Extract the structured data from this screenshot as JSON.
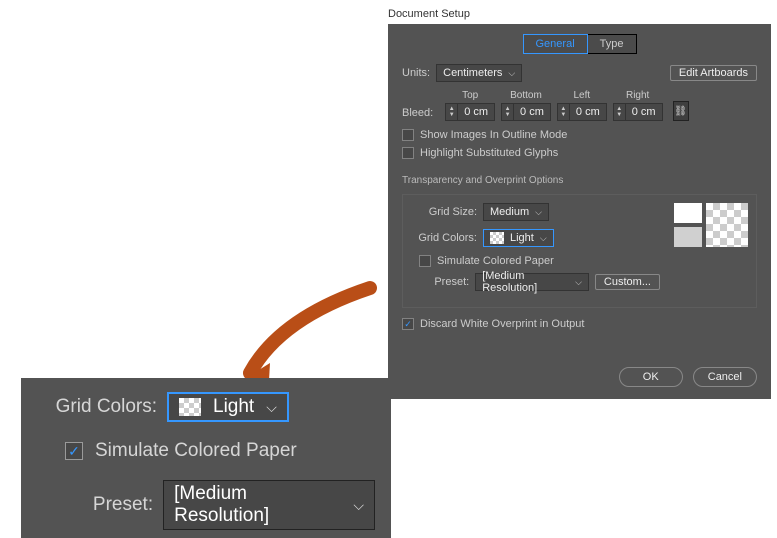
{
  "panelTitle": "Document Setup",
  "tabs": {
    "general": "General",
    "type": "Type"
  },
  "units": {
    "label": "Units:",
    "value": "Centimeters"
  },
  "editArtboards": "Edit Artboards",
  "bleed": {
    "label": "Bleed:",
    "top": {
      "label": "Top",
      "value": "0 cm"
    },
    "bottom": {
      "label": "Bottom",
      "value": "0 cm"
    },
    "left": {
      "label": "Left",
      "value": "0 cm"
    },
    "right": {
      "label": "Right",
      "value": "0 cm"
    }
  },
  "showOutline": "Show Images In Outline Mode",
  "highlightGlyphs": "Highlight Substituted Glyphs",
  "transparencyTitle": "Transparency and Overprint Options",
  "gridSize": {
    "label": "Grid Size:",
    "value": "Medium"
  },
  "gridColors": {
    "label": "Grid Colors:",
    "value": "Light"
  },
  "simulate": "Simulate Colored Paper",
  "preset": {
    "label": "Preset:",
    "value": "[Medium Resolution]"
  },
  "custom": "Custom...",
  "discard": "Discard White Overprint in Output",
  "ok": "OK",
  "cancel": "Cancel",
  "zoom": {
    "gridColorsLabel": "Grid Colors:",
    "gridColorsValue": "Light",
    "simulate": "Simulate Colored Paper",
    "presetLabel": "Preset:",
    "presetValue": "[Medium Resolution]"
  }
}
